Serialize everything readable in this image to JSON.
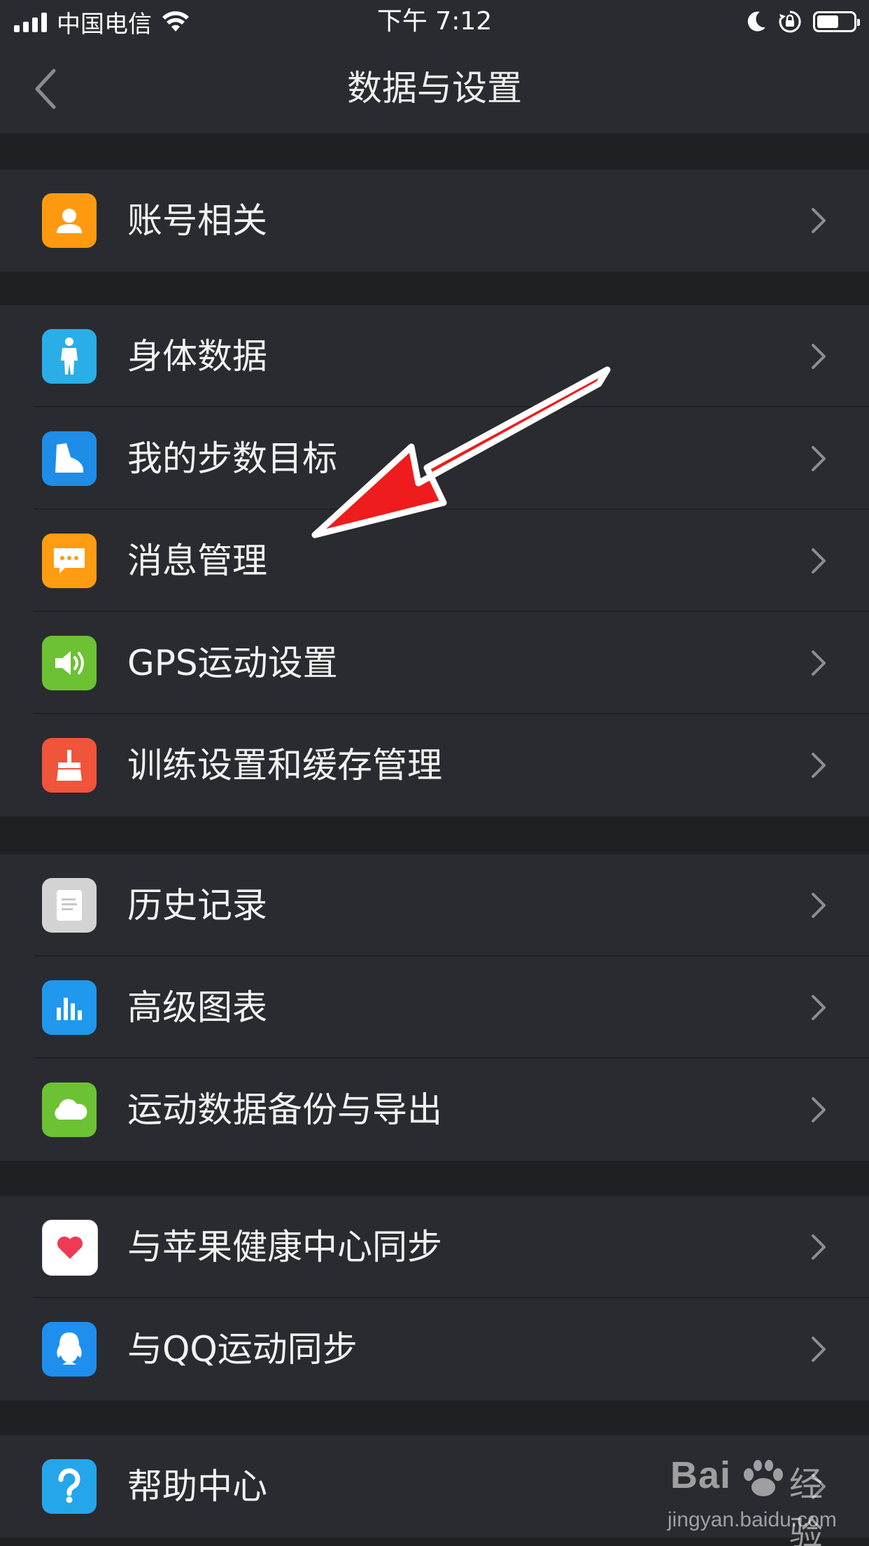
{
  "status_bar": {
    "carrier": "中国电信",
    "time": "下午 7:12",
    "battery_level": 0.6
  },
  "nav": {
    "title": "数据与设置",
    "back_icon": "chevron-left-icon"
  },
  "groups": [
    {
      "items": [
        {
          "label": "账号相关",
          "icon": "user-icon",
          "color": "#ff9a10"
        }
      ]
    },
    {
      "items": [
        {
          "label": "身体数据",
          "icon": "person-icon",
          "color": "#29aee8"
        },
        {
          "label": "我的步数目标",
          "icon": "shoe-icon",
          "color": "#1e8de8"
        },
        {
          "label": "消息管理",
          "icon": "chat-bubble-icon",
          "color": "#ff9c12"
        },
        {
          "label": "GPS运动设置",
          "icon": "speaker-icon",
          "color": "#6cc232"
        },
        {
          "label": "训练设置和缓存管理",
          "icon": "broom-icon",
          "color": "#f0543a"
        }
      ]
    },
    {
      "items": [
        {
          "label": "历史记录",
          "icon": "document-icon",
          "color": "#d3d3d3"
        },
        {
          "label": "高级图表",
          "icon": "bar-chart-icon",
          "color": "#1f98ee"
        },
        {
          "label": "运动数据备份与导出",
          "icon": "cloud-icon",
          "color": "#6cc232"
        }
      ]
    },
    {
      "items": [
        {
          "label": "与苹果健康中心同步",
          "icon": "heart-icon",
          "color": "#ffffff"
        },
        {
          "label": "与QQ运动同步",
          "icon": "qq-penguin-icon",
          "color": "#1e8fef"
        }
      ]
    },
    {
      "items": [
        {
          "label": "帮助中心",
          "icon": "question-icon",
          "color": "#25a6ea"
        }
      ]
    }
  ],
  "watermark": {
    "brand": "Bai",
    "brand_suffix": "经验",
    "url": "jingyan.baidu.com"
  },
  "annotation": {
    "type": "red-arrow",
    "points_to": "消息管理",
    "color": "#ee1c1c"
  }
}
